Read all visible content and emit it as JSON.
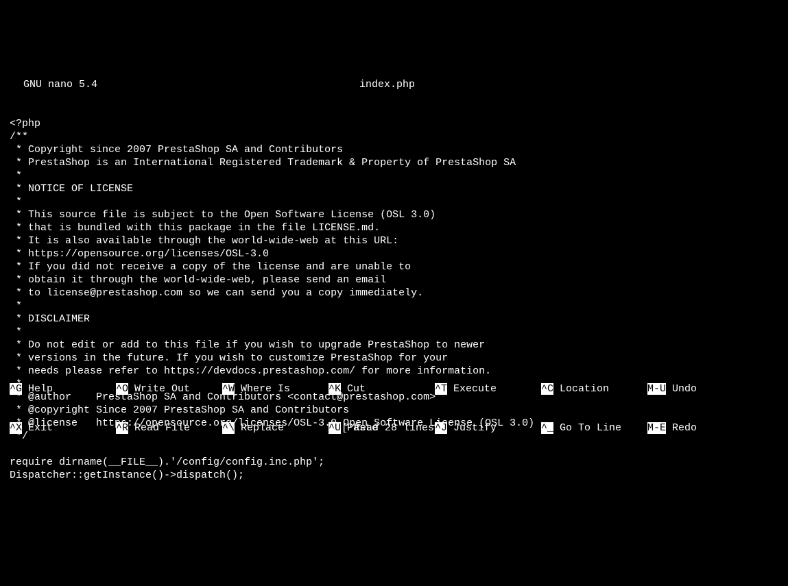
{
  "header": {
    "editor_name": "GNU nano 5.4",
    "filename": "index.php"
  },
  "content": {
    "lines": [
      "<?php",
      "/**",
      " * Copyright since 2007 PrestaShop SA and Contributors",
      " * PrestaShop is an International Registered Trademark & Property of PrestaShop SA",
      " *",
      " * NOTICE OF LICENSE",
      " *",
      " * This source file is subject to the Open Software License (OSL 3.0)",
      " * that is bundled with this package in the file LICENSE.md.",
      " * It is also available through the world-wide-web at this URL:",
      " * https://opensource.org/licenses/OSL-3.0",
      " * If you did not receive a copy of the license and are unable to",
      " * obtain it through the world-wide-web, please send an email",
      " * to license@prestashop.com so we can send you a copy immediately.",
      " *",
      " * DISCLAIMER",
      " *",
      " * Do not edit or add to this file if you wish to upgrade PrestaShop to newer",
      " * versions in the future. If you wish to customize PrestaShop for your",
      " * needs please refer to https://devdocs.prestashop.com/ for more information.",
      " *",
      " * @author    PrestaShop SA and Contributors <contact@prestashop.com>",
      " * @copyright Since 2007 PrestaShop SA and Contributors",
      " * @license   https://opensource.org/licenses/OSL-3.0 Open Software License (OSL 3.0)",
      " */",
      "",
      "require dirname(__FILE__).'/config/config.inc.php';",
      "Dispatcher::getInstance()->dispatch();"
    ]
  },
  "status": {
    "message": "[ Read 28 lines ]"
  },
  "shortcuts": {
    "row1": [
      {
        "key": "^G",
        "label": " Help"
      },
      {
        "key": "^O",
        "label": " Write Out"
      },
      {
        "key": "^W",
        "label": " Where Is"
      },
      {
        "key": "^K",
        "label": " Cut"
      },
      {
        "key": "^T",
        "label": " Execute"
      },
      {
        "key": "^C",
        "label": " Location"
      },
      {
        "key": "M-U",
        "label": " Undo"
      }
    ],
    "row2": [
      {
        "key": "^X",
        "label": " Exit"
      },
      {
        "key": "^R",
        "label": " Read File"
      },
      {
        "key": "^\\",
        "label": " Replace"
      },
      {
        "key": "^U",
        "label": " Paste"
      },
      {
        "key": "^J",
        "label": " Justify"
      },
      {
        "key": "^_",
        "label": " Go To Line"
      },
      {
        "key": "M-E",
        "label": " Redo"
      }
    ]
  }
}
